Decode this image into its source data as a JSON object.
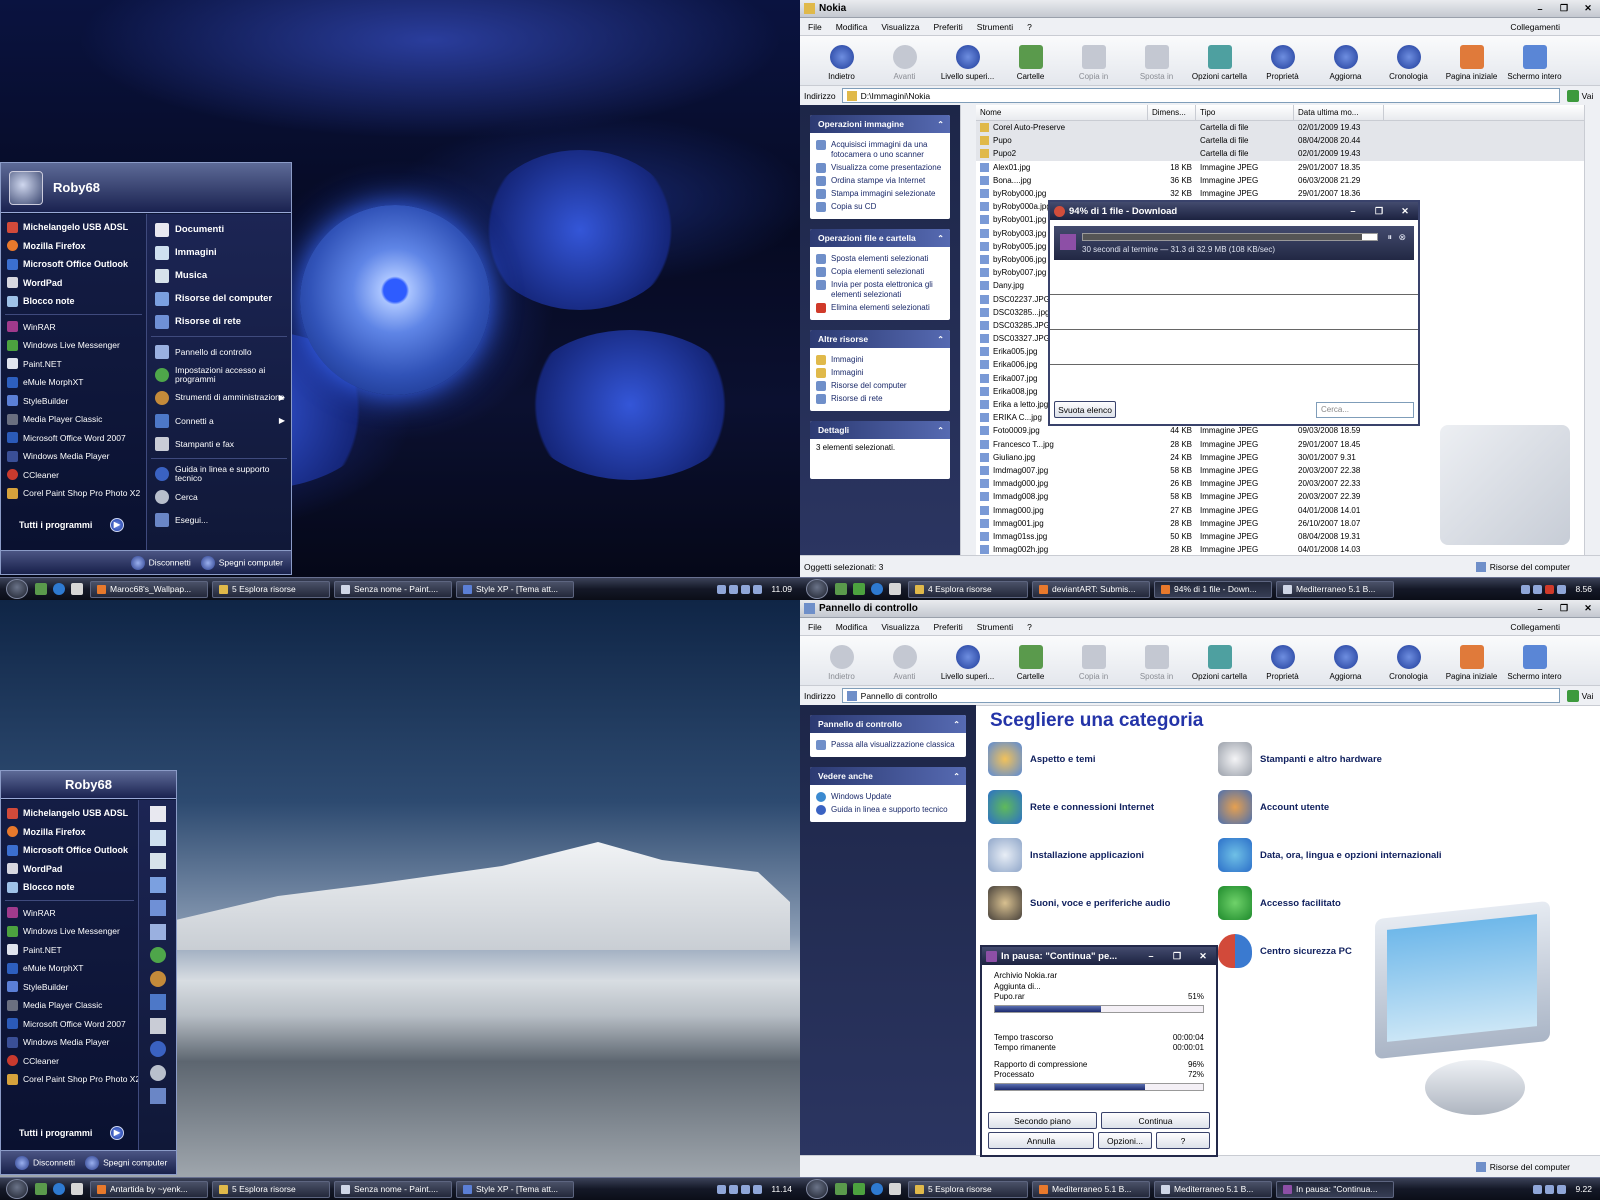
{
  "tl": {
    "user": "Roby68",
    "pinned": [
      "Michelangelo USB ADSL",
      "Mozilla Firefox",
      "Microsoft Office Outlook",
      "WordPad",
      "Blocco note"
    ],
    "recent": [
      "WinRAR",
      "Windows Live Messenger",
      "Paint.NET",
      "eMule MorphXT",
      "StyleBuilder",
      "Media Player Classic",
      "Microsoft Office Word 2007",
      "Windows Media Player",
      "CCleaner",
      "Corel Paint Shop Pro Photo X2"
    ],
    "all_programs": "Tutti i programmi",
    "places_bold": [
      "Documenti",
      "Immagini",
      "Musica",
      "Risorse del computer",
      "Risorse di rete"
    ],
    "places": [
      "Pannello di controllo",
      "Impostazioni accesso ai programmi",
      "Strumenti di amministrazione",
      "Connetti a",
      "Stampanti e fax",
      "Guida in linea e supporto tecnico",
      "Cerca",
      "Esegui..."
    ],
    "disconnect": "Disconnetti",
    "shutdown": "Spegni computer",
    "tasks": [
      "Maroc68's_Wallpap...",
      "5 Esplora risorse",
      "Senza nome - Paint....",
      "Style XP - [Tema att..."
    ],
    "clock": "11.09"
  },
  "tr": {
    "title": "Nokia",
    "menu": [
      "File",
      "Modifica",
      "Visualizza",
      "Preferiti",
      "Strumenti",
      "?"
    ],
    "links": "Collegamenti",
    "toolbar": [
      "Indietro",
      "Avanti",
      "Livello superi...",
      "Cartelle",
      "Copia in",
      "Sposta in",
      "Opzioni cartella",
      "Proprietà",
      "Aggiorna",
      "Cronologia",
      "Pagina iniziale",
      "Schermo intero"
    ],
    "addr_label": "Indirizzo",
    "addr": "D:\\Immagini\\Nokia",
    "go": "Vai",
    "p1_title": "Operazioni immagine",
    "p1": [
      "Acquisisci immagini da una fotocamera o uno scanner",
      "Visualizza come presentazione",
      "Ordina stampe via Internet",
      "Stampa immagini selezionate",
      "Copia su CD"
    ],
    "p2_title": "Operazioni file e cartella",
    "p2": [
      "Sposta elementi selezionati",
      "Copia elementi selezionati",
      "Invia per posta elettronica gli elementi selezionati",
      "Elimina elementi selezionati"
    ],
    "p3_title": "Altre risorse",
    "p3": [
      "Immagini",
      "Immagini",
      "Risorse del computer",
      "Risorse di rete"
    ],
    "p4_title": "Dettagli",
    "p4": "3 elementi selezionati.",
    "cols": [
      "Nome",
      "Dimens...",
      "Tipo",
      "Data ultima mo..."
    ],
    "files": [
      [
        "Corel Auto-Preserve",
        "",
        "Cartella di file",
        "02/01/2009 19.43"
      ],
      [
        "Pupo",
        "",
        "Cartella di file",
        "08/04/2008 20.44"
      ],
      [
        "Pupo2",
        "",
        "Cartella di file",
        "02/01/2009 19.43"
      ],
      [
        "Alex01.jpg",
        "18 KB",
        "Immagine JPEG",
        "29/01/2007 18.35"
      ],
      [
        "Bona....jpg",
        "36 KB",
        "Immagine JPEG",
        "06/03/2008 21.29"
      ],
      [
        "byRoby000.jpg",
        "32 KB",
        "Immagine JPEG",
        "29/01/2007 18.36"
      ],
      [
        "byRoby000a.jpg",
        "",
        "",
        ""
      ],
      [
        "byRoby001.jpg",
        "",
        "",
        ""
      ],
      [
        "byRoby003.jpg",
        "",
        "",
        ""
      ],
      [
        "byRoby005.jpg",
        "",
        "",
        ""
      ],
      [
        "byRoby006.jpg",
        "",
        "",
        ""
      ],
      [
        "byRoby007.jpg",
        "",
        "",
        ""
      ],
      [
        "Dany.jpg",
        "",
        "",
        ""
      ],
      [
        "DSC02237.JPG",
        "",
        "",
        ""
      ],
      [
        "DSC03285...jpg",
        "",
        "",
        ""
      ],
      [
        "DSC03285.JPG",
        "",
        "",
        ""
      ],
      [
        "DSC03327.JPG",
        "",
        "",
        ""
      ],
      [
        "Erika005.jpg",
        "",
        "",
        ""
      ],
      [
        "Erika006.jpg",
        "",
        "",
        ""
      ],
      [
        "Erika007.jpg",
        "",
        "",
        ""
      ],
      [
        "Erika008.jpg",
        "",
        "",
        ""
      ],
      [
        "Erika a letto.jpg",
        "",
        "",
        ""
      ],
      [
        "ERIKA C...jpg",
        "",
        "",
        ""
      ],
      [
        "Foto0009.jpg",
        "44 KB",
        "Immagine JPEG",
        "09/03/2008 18.59"
      ],
      [
        "Francesco T...jpg",
        "28 KB",
        "Immagine JPEG",
        "29/01/2007 18.45"
      ],
      [
        "Giuliano.jpg",
        "24 KB",
        "Immagine JPEG",
        "30/01/2007 9.31"
      ],
      [
        "Imdmag007.jpg",
        "58 KB",
        "Immagine JPEG",
        "20/03/2007 22.38"
      ],
      [
        "Immadg000.jpg",
        "26 KB",
        "Immagine JPEG",
        "20/03/2007 22.33"
      ],
      [
        "Immadg008.jpg",
        "58 KB",
        "Immagine JPEG",
        "20/03/2007 22.39"
      ],
      [
        "Immag000.jpg",
        "27 KB",
        "Immagine JPEG",
        "04/01/2008 14.01"
      ],
      [
        "Immag001.jpg",
        "28 KB",
        "Immagine JPEG",
        "26/10/2007 18.07"
      ],
      [
        "Immag01ss.jpg",
        "50 KB",
        "Immagine JPEG",
        "08/04/2008 19.31"
      ],
      [
        "Immag002h.jpg",
        "28 KB",
        "Immagine JPEG",
        "04/01/2008 14.03"
      ]
    ],
    "status": "Oggetti selezionati: 3",
    "status_r": "Risorse del computer",
    "dl_title": "94% di 1 file - Download",
    "dl_info": "30 secondi al termine — 31.3 di 32.9 MB (108 KB/sec)",
    "dl_progress": 0.95,
    "dl_clear": "Svuota elenco",
    "dl_search": "Cerca...",
    "tasks": [
      "4 Esplora risorse",
      "deviantART: Submis...",
      "94% di 1 file - Down...",
      "Mediterraneo 5.1 B..."
    ],
    "clock": "8.56"
  },
  "bl": {
    "user": "Roby68",
    "pinned": [
      "Michelangelo USB ADSL",
      "Mozilla Firefox",
      "Microsoft Office Outlook",
      "WordPad",
      "Blocco note"
    ],
    "recent": [
      "WinRAR",
      "Windows Live Messenger",
      "Paint.NET",
      "eMule MorphXT",
      "StyleBuilder",
      "Media Player Classic",
      "Microsoft Office Word 2007",
      "Windows Media Player",
      "CCleaner",
      "Corel Paint Shop Pro Photo X2"
    ],
    "all_programs": "Tutti i programmi",
    "disconnect": "Disconnetti",
    "shutdown": "Spegni computer",
    "tasks": [
      "Antartida by ~yenk...",
      "5 Esplora risorse",
      "Senza nome - Paint....",
      "Style XP - [Tema att..."
    ],
    "clock": "11.14"
  },
  "br": {
    "title": "Pannello di controllo",
    "addr": "Pannello di controllo",
    "p1_title": "Pannello di controllo",
    "p1": [
      "Passa alla visualizzazione classica"
    ],
    "p2_title": "Vedere anche",
    "p2": [
      "Windows Update",
      "Guida in linea e supporto tecnico"
    ],
    "heading": "Scegliere una categoria",
    "cats_l": [
      "Aspetto e temi",
      "Rete e connessioni Internet",
      "Installazione applicazioni",
      "Suoni, voce e periferiche audio"
    ],
    "cats_r": [
      "Stampanti e altro hardware",
      "Account utente",
      "Data, ora, lingua e opzioni internazionali",
      "Accesso facilitato",
      "Centro sicurezza PC"
    ],
    "rar_title": "In pausa: \"Continua\" pe...",
    "rar_arch": "Archivio Nokia.rar",
    "rar_add": "Aggiunta di...",
    "rar_file": "Pupo.rar",
    "rar_file_pct": "51%",
    "rar_file_progress": 0.51,
    "rar_elapsed_l": "Tempo trascorso",
    "rar_elapsed": "00:00:04",
    "rar_left_l": "Tempo rimanente",
    "rar_left": "00:00:01",
    "rar_ratio_l": "Rapporto di compressione",
    "rar_ratio": "96%",
    "rar_proc_l": "Processato",
    "rar_proc": "72%",
    "rar_total_progress": 0.72,
    "rar_btns": [
      "Secondo piano",
      "Continua",
      "Annulla",
      "Opzioni...",
      "?"
    ],
    "status_r": "Risorse del computer",
    "tasks": [
      "5 Esplora risorse",
      "Mediterraneo 5.1 B...",
      "Mediterraneo 5.1 B...",
      "In pausa: \"Continua..."
    ],
    "clock": "9.22"
  }
}
